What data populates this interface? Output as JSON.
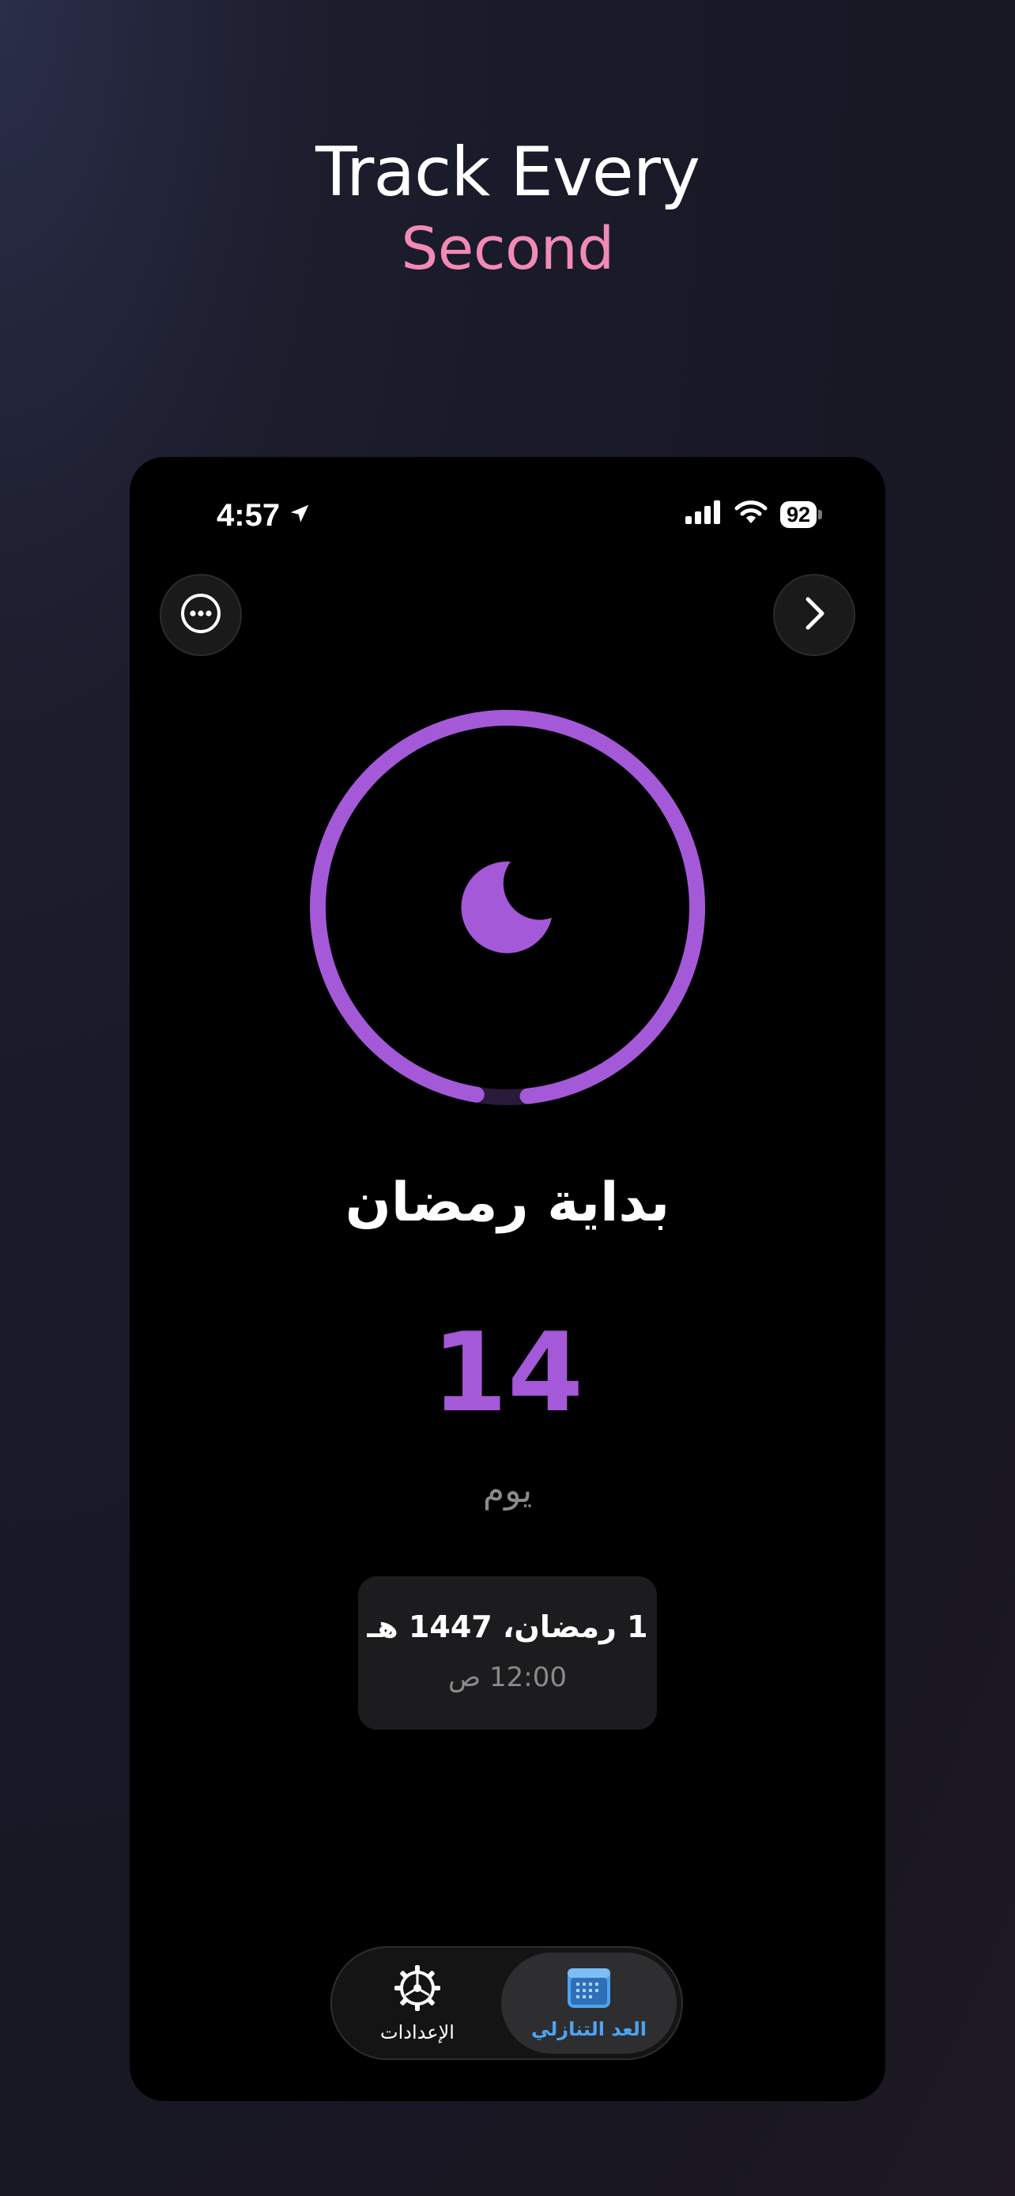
{
  "promo": {
    "headline_line1": "Track Every",
    "headline_line2": "Second",
    "headline_accent_color": "#f28ab5"
  },
  "status_bar": {
    "time": "4:57",
    "battery": "92",
    "icons": [
      "location-arrow-icon",
      "cellular-signal-icon",
      "wifi-icon",
      "battery-icon"
    ]
  },
  "top_buttons": {
    "left_icon": "more-options-icon",
    "right_icon": "chevron-right-icon"
  },
  "countdown": {
    "event_title": "بداية رمضان",
    "value": "14",
    "unit": "يوم",
    "progress": 0.97,
    "accent_color": "#a459d8",
    "center_icon": "crescent-moon-icon"
  },
  "target_date": {
    "date": "1 رمضان، 1447 هـ",
    "time": "12:00 ص"
  },
  "tab_bar": {
    "tabs": [
      {
        "label": "الإعدادات",
        "icon": "settings-gear-icon",
        "selected": false
      },
      {
        "label": "العد التنازلي",
        "icon": "calendar-icon",
        "selected": true
      }
    ],
    "selected_color": "#4ea3f0"
  }
}
